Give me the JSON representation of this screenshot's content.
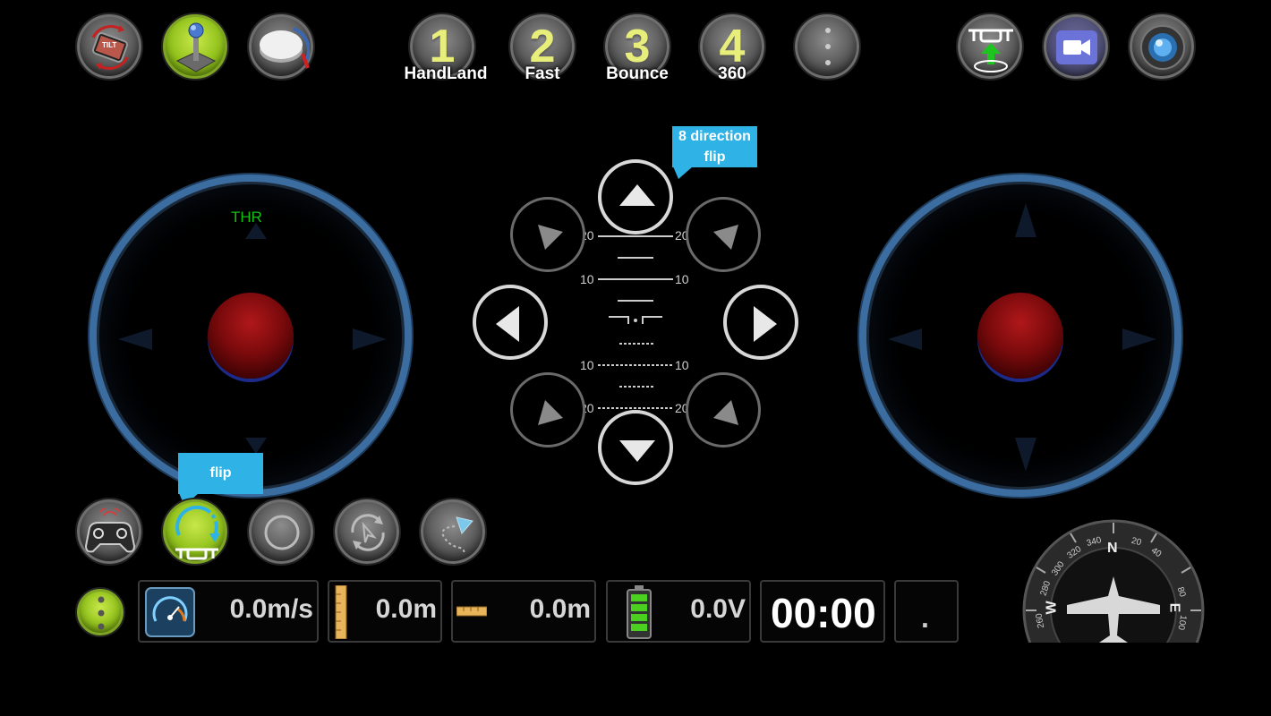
{
  "top_left_buttons": [
    {
      "icon": "tilt-phone-icon"
    },
    {
      "icon": "joystick-icon"
    },
    {
      "icon": "knob-dial-icon"
    }
  ],
  "tilt_badge": "TILT",
  "modes": [
    {
      "number": "1",
      "label": "HandLand"
    },
    {
      "number": "2",
      "label": "Fast"
    },
    {
      "number": "3",
      "label": "Bounce"
    },
    {
      "number": "4",
      "label": "360"
    }
  ],
  "top_right_buttons": [
    {
      "icon": "drone-takeoff-icon"
    },
    {
      "icon": "video-camera-icon"
    },
    {
      "icon": "photo-capture-icon"
    }
  ],
  "left_stick": {
    "label": "THR"
  },
  "flip_pad": {
    "callout": "8 direction flip",
    "ladder": {
      "top": "20",
      "upper": "10",
      "lower": "10",
      "bottom": "20"
    }
  },
  "flip_callout": "flip",
  "bottom_buttons": [
    {
      "icon": "gamepad-icon"
    },
    {
      "icon": "flip-drone-icon"
    },
    {
      "icon": "circle-fly-icon"
    },
    {
      "icon": "rotate-navigate-icon"
    },
    {
      "icon": "path-plan-icon"
    }
  ],
  "stats": {
    "speed": "0.0m/s",
    "height": "0.0m",
    "distance": "0.0m",
    "voltage": "0.0V",
    "timer": "00:00",
    "extra": "."
  },
  "compass": {
    "n": "N",
    "e": "E",
    "w": "W",
    "ticks": [
      "340",
      "20",
      "40",
      "320",
      "300",
      "280",
      "260",
      "80",
      "100"
    ]
  },
  "colors": {
    "accent_blue": "#2fb3e6",
    "stick_ring": "#3c6da0",
    "thr_green": "#12c012",
    "mode_digit": "#e8ee7a"
  }
}
